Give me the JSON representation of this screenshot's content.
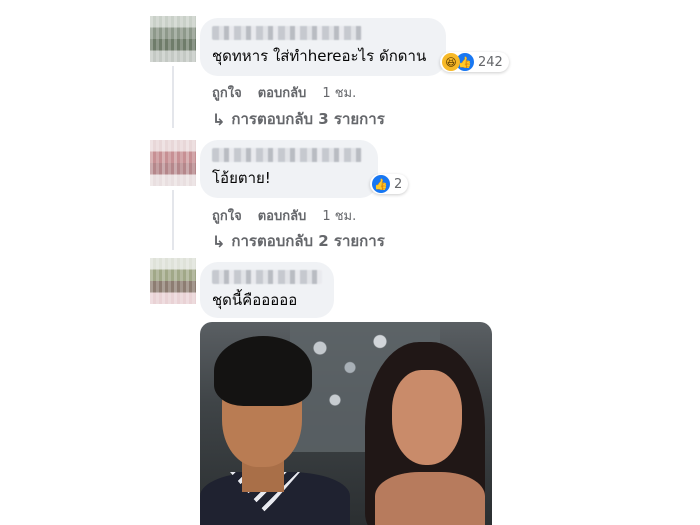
{
  "comments": [
    {
      "text": "ชุดทหาร ใส่ทำhereอะไร ดักดาน",
      "reaction_count": "242",
      "reactions": [
        "haha-icon",
        "like-icon"
      ],
      "actions": {
        "like": "ถูกใจ",
        "reply": "ตอบกลับ",
        "time": "1 ชม."
      },
      "replies_label": "การตอบกลับ 3 รายการ"
    },
    {
      "text": "โอ้ยตาย!",
      "reaction_count": "2",
      "reactions": [
        "like-icon"
      ],
      "actions": {
        "like": "ถูกใจ",
        "reply": "ตอบกลับ",
        "time": "1 ชม."
      },
      "replies_label": "การตอบกลับ 2 รายการ"
    },
    {
      "text": "ชุดนี้คือออออ"
    }
  ],
  "icons": {
    "reply_arrow": "↳"
  },
  "colors": {
    "bubble": "#f0f2f5",
    "muted": "#65676b",
    "like": "#1877f2",
    "haha": "#f7b928"
  }
}
